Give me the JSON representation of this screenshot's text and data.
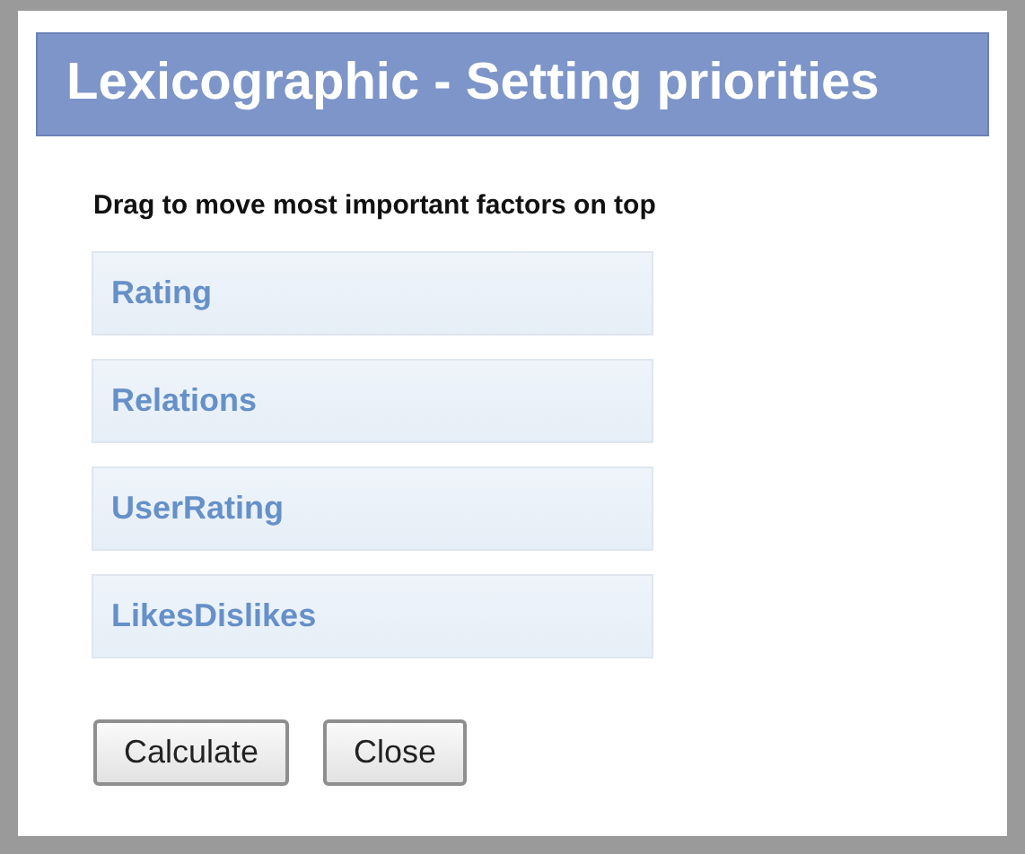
{
  "window": {
    "title": "Lexicographic - Setting priorities"
  },
  "instruction": "Drag to move most important factors on top",
  "factors": [
    {
      "label": "Rating"
    },
    {
      "label": "Relations"
    },
    {
      "label": "UserRating"
    },
    {
      "label": "LikesDislikes"
    }
  ],
  "buttons": [
    {
      "label": "Calculate"
    },
    {
      "label": "Close"
    }
  ]
}
